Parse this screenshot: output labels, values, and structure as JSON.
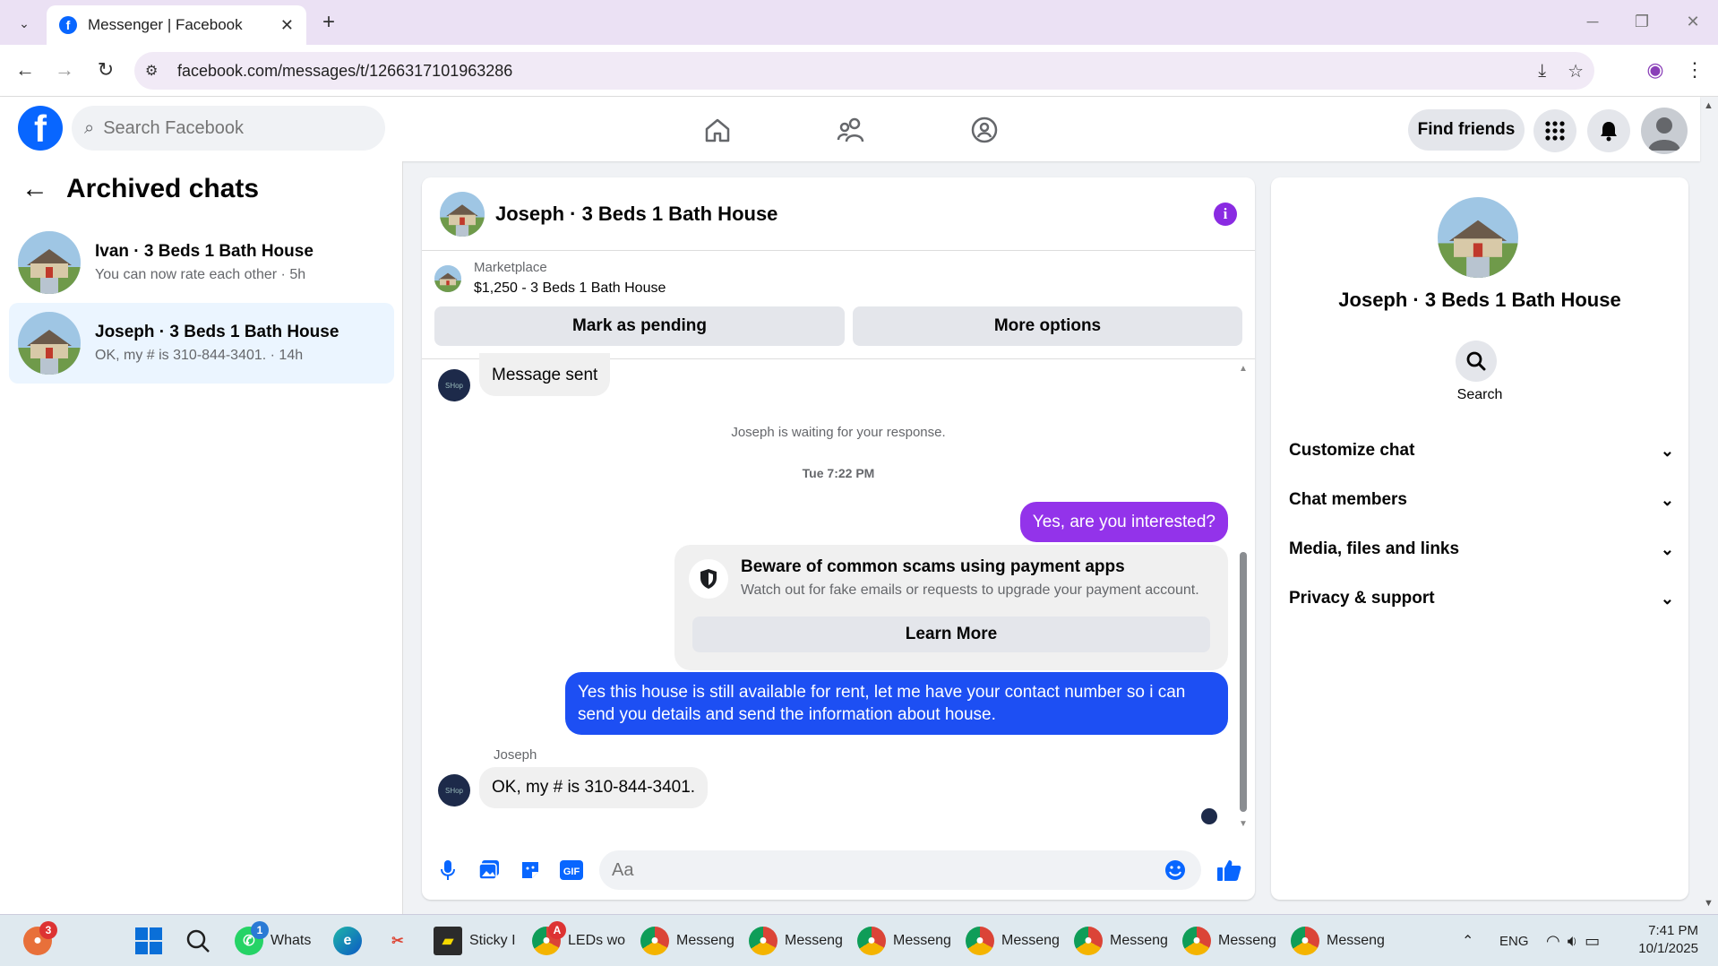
{
  "browser": {
    "tab_title": "Messenger | Facebook",
    "url": "facebook.com/messages/t/1266317101963286"
  },
  "fb": {
    "search_placeholder": "Search Facebook",
    "find_friends": "Find friends"
  },
  "left": {
    "title": "Archived chats",
    "chats": [
      {
        "name": "Ivan · 3 Beds 1 Bath House",
        "preview": "You can now rate each other · 5h",
        "selected": false
      },
      {
        "name": "Joseph · 3 Beds 1 Bath House",
        "preview": "OK, my # is 310-844-3401. · 14h",
        "selected": true
      }
    ]
  },
  "chat": {
    "title": "Joseph · 3 Beds 1 Bath House",
    "marketplace_label": "Marketplace",
    "listing": "$1,250 - 3 Beds 1 Bath House",
    "btn_pending": "Mark as pending",
    "btn_more": "More options",
    "msg_sent": "Message sent",
    "waiting": "Joseph is waiting for your response.",
    "timestamp": "Tue 7:22 PM",
    "out1": "Yes, are you interested?",
    "scam_title": "Beware of common scams using payment apps",
    "scam_desc": "Watch out for fake emails or requests to upgrade your payment account.",
    "learn_more": "Learn More",
    "out2": "Yes this house is still available for rent, let me have your contact number so i can send you details and send the information about house.",
    "sender": "Joseph",
    "in_last": "OK, my # is 310-844-3401.",
    "composer_placeholder": "Aa",
    "out1_color": "#9333ea",
    "out2_color": "#1d4ff3"
  },
  "right": {
    "name": "Joseph · 3 Beds 1 Bath House",
    "search": "Search",
    "rows": [
      "Customize chat",
      "Chat members",
      "Media, files and links",
      "Privacy & support"
    ]
  },
  "taskbar": {
    "items": [
      "Whats",
      "Sticky I",
      "LEDs wo",
      "Messeng",
      "Messeng",
      "Messeng",
      "Messeng",
      "Messeng",
      "Messeng",
      "Messeng"
    ],
    "lang": "ENG",
    "time": "7:41 PM",
    "date": "10/1/2025",
    "badge_app": "3",
    "badge_whatsapp": "1",
    "badge_leds": "A"
  }
}
